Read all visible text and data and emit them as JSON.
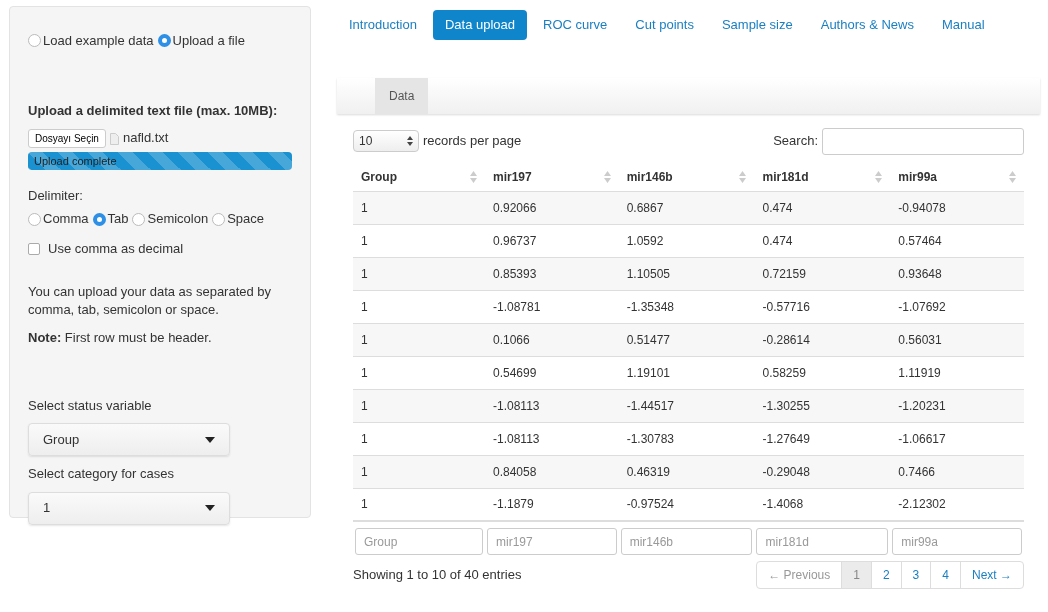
{
  "source_options": [
    {
      "label": "Load example data",
      "selected": false
    },
    {
      "label": "Upload a file",
      "selected": true
    }
  ],
  "upload": {
    "label": "Upload a delimited text file (max. 10MB):",
    "button": "Dosyayı Seçin",
    "filename": "nafld.txt",
    "progress": {
      "label": "Upload complete",
      "level": 1
    }
  },
  "delimiter": {
    "label": "Delimiter:",
    "options": [
      {
        "label": "Comma",
        "selected": false
      },
      {
        "label": "Tab",
        "selected": true
      },
      {
        "label": "Semicolon",
        "selected": false
      },
      {
        "label": "Space",
        "selected": false
      }
    ]
  },
  "decimal_checkbox": {
    "label": "Use comma as decimal",
    "checked": false
  },
  "help_text": "You can upload your data as separated by comma, tab, semicolon or space.",
  "note": "**Note:** First row must be header.",
  "status_select": {
    "label": "Select status variable",
    "value": "Group"
  },
  "category_select": {
    "label": "Select category for cases",
    "value": "1"
  },
  "nav_tabs": [
    {
      "label": "Introduction",
      "selected": false
    },
    {
      "label": "Data upload",
      "selected": true
    },
    {
      "label": "ROC curve",
      "selected": false
    },
    {
      "label": "Cut points",
      "selected": false
    },
    {
      "label": "Sample size",
      "selected": false
    },
    {
      "label": "Authors & News",
      "selected": false
    },
    {
      "label": "Manual",
      "selected": false
    }
  ],
  "sub_tabs": [
    {
      "label": "Data",
      "selected": true
    }
  ],
  "length_menu": {
    "value": "10",
    "label": "records per page"
  },
  "search": {
    "label": "Search:"
  },
  "table": {
    "columns": [
      "Group",
      "mir197",
      "mir146b",
      "mir181d",
      "mir99a"
    ],
    "rows": [
      [
        "1",
        "0.92066",
        "0.6867",
        "0.474",
        "-0.94078"
      ],
      [
        "1",
        "0.96737",
        "1.0592",
        "0.474",
        "0.57464"
      ],
      [
        "1",
        "0.85393",
        "1.10505",
        "0.72159",
        "0.93648"
      ],
      [
        "1",
        "-1.08781",
        "-1.35348",
        "-0.57716",
        "-1.07692"
      ],
      [
        "1",
        "0.1066",
        "0.51477",
        "-0.28614",
        "0.56031"
      ],
      [
        "1",
        "0.54699",
        "1.19101",
        "0.58259",
        "1.11919"
      ],
      [
        "1",
        "-1.08113",
        "-1.44517",
        "-1.30255",
        "-1.20231"
      ],
      [
        "1",
        "-1.08113",
        "-1.30783",
        "-1.27649",
        "-1.06617"
      ],
      [
        "1",
        "0.84058",
        "0.46319",
        "-0.29048",
        "0.7466"
      ],
      [
        "1",
        "-1.1879",
        "-0.97524",
        "-1.4068",
        "-2.12302"
      ]
    ],
    "filters": [
      {
        "placeholder": "Group"
      },
      {
        "placeholder": "mir197"
      },
      {
        "placeholder": "mir146b"
      },
      {
        "placeholder": "mir181d"
      },
      {
        "placeholder": "mir99a"
      }
    ]
  },
  "info": "Showing 1 to 10 of 40 entries",
  "pagination": [
    {
      "label": "← Previous",
      "disabled": true,
      "selected": false
    },
    {
      "label": "1",
      "disabled": false,
      "selected": true
    },
    {
      "label": "2",
      "disabled": false,
      "selected": false
    },
    {
      "label": "3",
      "disabled": false,
      "selected": false
    },
    {
      "label": "4",
      "disabled": false,
      "selected": false
    },
    {
      "label": "Next →",
      "disabled": false,
      "selected": false
    }
  ]
}
